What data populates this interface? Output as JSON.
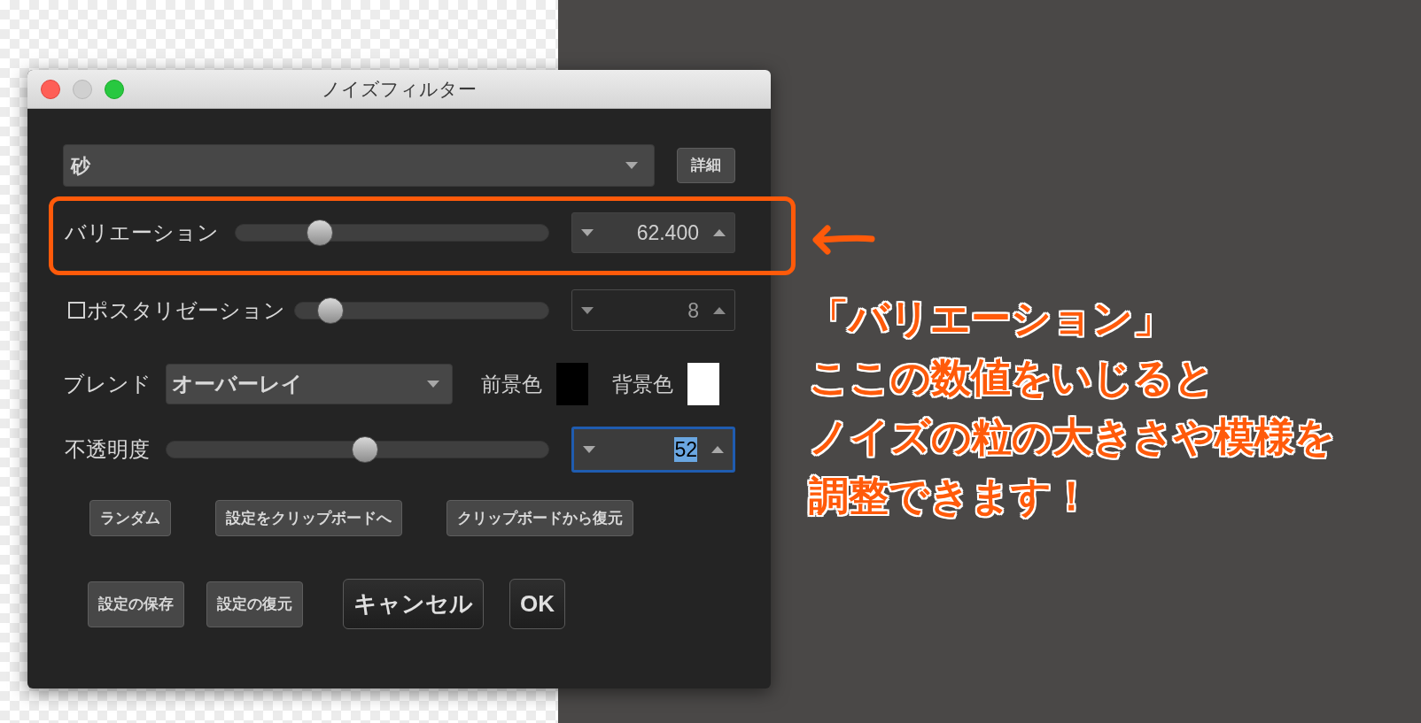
{
  "window": {
    "title": "ノイズフィルター"
  },
  "preset": {
    "value": "砂",
    "button": "詳細"
  },
  "rows": [
    {
      "kind": "slider",
      "label": "バリエーション",
      "level": 0.25,
      "value": "62.400",
      "highlighted": true,
      "focused": false,
      "disabled": false
    },
    {
      "kind": "check_slider",
      "label": "ポスタリゼーション",
      "checked": false,
      "level": 0.1,
      "value": "8",
      "highlighted": false,
      "focused": false,
      "disabled": true
    },
    {
      "kind": "blend",
      "label": "ブレンド",
      "value": "オーバーレイ",
      "swatches": [
        {
          "label": "前景色",
          "color": "#000000"
        },
        {
          "label": "背景色",
          "color": "#ffffff"
        }
      ]
    },
    {
      "kind": "slider",
      "label": "不透明度",
      "level": 0.52,
      "value": "52",
      "highlighted": false,
      "focused": true,
      "disabled": false
    }
  ],
  "clipboard_buttons": [
    "ランダム",
    "設定をクリップボードへ",
    "クリップボードから復元"
  ],
  "footer_buttons": [
    {
      "kind": "small",
      "label": "設定の保存"
    },
    {
      "kind": "small",
      "label": "設定の復元"
    },
    {
      "kind": "large",
      "label": "キャンセル"
    },
    {
      "kind": "large",
      "label": "OK"
    }
  ],
  "annotation": {
    "lines": [
      "「バリエーション」",
      "ここの数値をいじると",
      "ノイズの粒の大きさや模様を",
      "調整できます！"
    ]
  }
}
